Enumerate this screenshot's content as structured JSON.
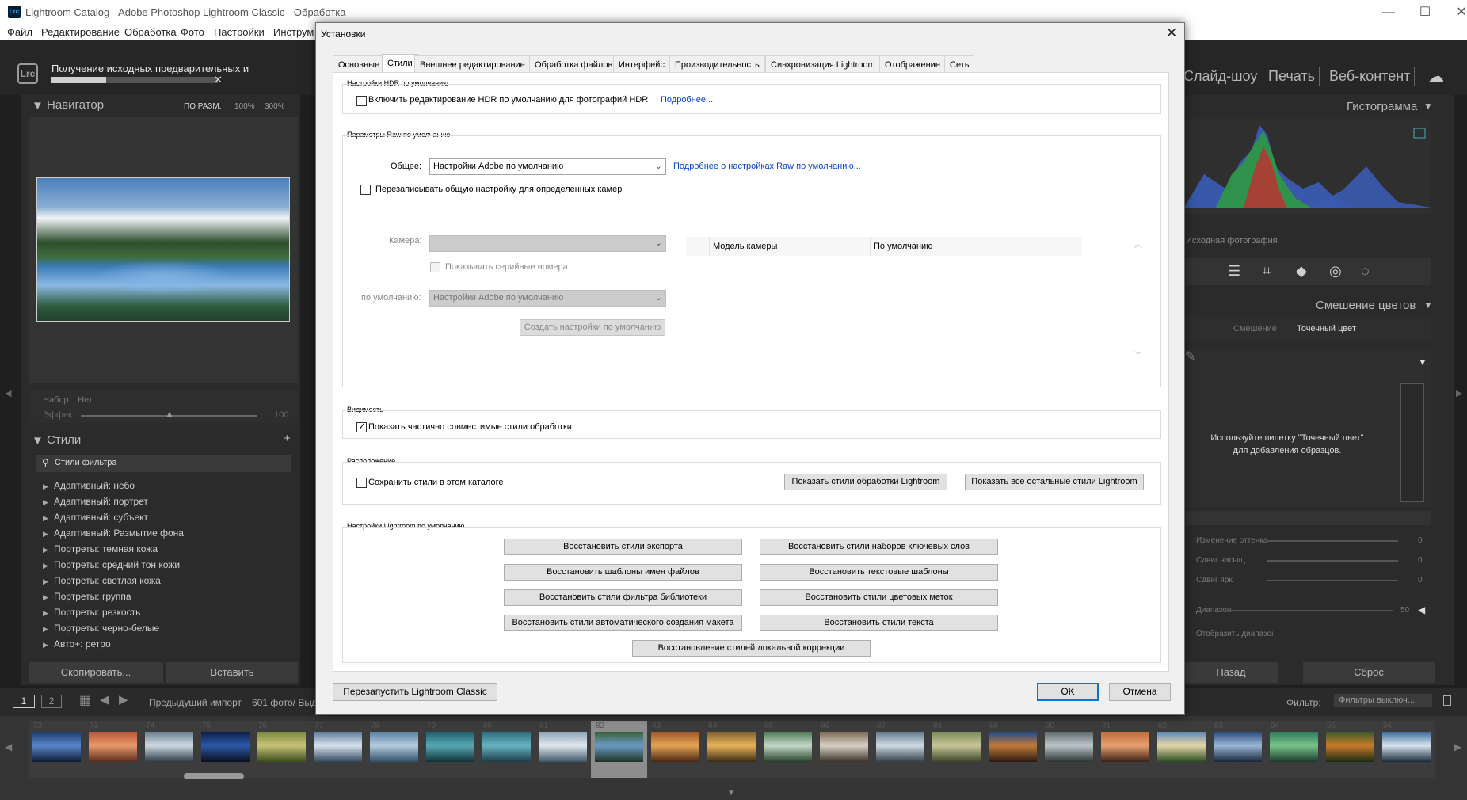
{
  "app": {
    "window_title": "Lightroom Catalog - Adobe Photoshop Lightroom Classic - Обработка",
    "logo_text": "Lrc",
    "menu": [
      "Файл",
      "Редактирование",
      "Обработка",
      "Фото",
      "Настройки",
      "Инструм"
    ],
    "import_status": "Получение исходных предварительных и",
    "import_progress_fraction": 0.33,
    "modules": [
      "Слайд-шоу",
      "Печать",
      "Веб-контент"
    ]
  },
  "left_panel": {
    "navigator_title": "Навигатор",
    "zoom_fit": "ПО РАЗМ.",
    "zoom_100": "100%",
    "zoom_300": "300%",
    "preset_label": "Набор:",
    "preset_value": "Нет",
    "effect_label": "Эффект",
    "effect_value": "100",
    "styles_title": "Стили",
    "styles_filter": "Стили фильтра",
    "style_groups": [
      "Адаптивный: небо",
      "Адаптивный: портрет",
      "Адаптивный: субъект",
      "Адаптивный: Размытие фона",
      "Портреты: темная кожа",
      "Портреты: средний тон кожи",
      "Портреты: светлая кожа",
      "Портреты: группа",
      "Портреты: резкость",
      "Портреты: черно-белые",
      "Авто+: ретро"
    ],
    "copy_button": "Скопировать...",
    "paste_button": "Вставить"
  },
  "right_panel": {
    "histogram_title": "Гистограмма",
    "original_photo": "Исходная фотография",
    "color_mix_title": "Смешение цветов",
    "tab_mix": "Смешение",
    "tab_point": "Точечный цвет",
    "point_hint_line1": "Используйте пипетку \"Точечный цвет\"",
    "point_hint_line2": "для добавления образцов.",
    "row_labels": [
      "Изменение оттенка",
      "Сдвиг насыщ.",
      "Сдвиг ярк.",
      "Диапазон"
    ],
    "row_values": [
      "0",
      "0",
      "0",
      "50"
    ],
    "show_range": "Отобразить диапазон",
    "back_button": "Назад",
    "reset_button": "Сброс"
  },
  "bottom": {
    "page_1": "1",
    "page_2": "2",
    "prev_import": "Предыдущий импорт",
    "count": "601 фото/ Выд",
    "filter_label": "Фильтр:",
    "filter_value": "Фильтры выключ..."
  },
  "filmstrip": {
    "numbers": [
      "72",
      "73",
      "74",
      "75",
      "76",
      "77",
      "78",
      "79",
      "80",
      "81",
      "82",
      "83",
      "84",
      "85",
      "86",
      "87",
      "88",
      "89",
      "90",
      "91",
      "92",
      "93",
      "94",
      "95",
      "96"
    ],
    "selected_index": 10,
    "thumb_colors": [
      [
        "#1e3a6e",
        "#5a86c8",
        "#0c1b33"
      ],
      [
        "#b8553a",
        "#e89a6b",
        "#5a2a1d"
      ],
      [
        "#6a7e8f",
        "#cfd9e2",
        "#2b3a45"
      ],
      [
        "#0c1f4a",
        "#2c58a8",
        "#0a0f1f"
      ],
      [
        "#7a8a3a",
        "#c8c37a",
        "#3a4a1a"
      ],
      [
        "#5d7b9a",
        "#d9e3ec",
        "#30465c"
      ],
      [
        "#5a7fa0",
        "#b4cde0",
        "#2f4f66"
      ],
      [
        "#1f5f6a",
        "#57a9b5",
        "#103236"
      ],
      [
        "#2c6c7a",
        "#67b4c2",
        "#1b3b44"
      ],
      [
        "#8aa2b5",
        "#e1e9ef",
        "#3d5566"
      ],
      [
        "#3c5f3a",
        "#6a9bc4",
        "#1e3324"
      ],
      [
        "#a0552a",
        "#e3a455",
        "#4a2512"
      ],
      [
        "#806030",
        "#e8b45a",
        "#3a2a12"
      ],
      [
        "#4f7a55",
        "#c4d9c8",
        "#25402a"
      ],
      [
        "#7b6a55",
        "#d8d0c4",
        "#3a3226"
      ],
      [
        "#617a8c",
        "#d0dbe3",
        "#2e3d48"
      ],
      [
        "#7a8a5a",
        "#c9c79a",
        "#3a4428"
      ],
      [
        "#1e4a8a",
        "#c07a3a",
        "#2a1a10"
      ],
      [
        "#5d6a6e",
        "#bcc6c8",
        "#2a3234"
      ],
      [
        "#c06a3a",
        "#e8a070",
        "#3a2014"
      ],
      [
        "#5a88b8",
        "#e6d7a8",
        "#2a4a22"
      ],
      [
        "#2a4a7a",
        "#9ab7d6",
        "#17253a"
      ],
      [
        "#2d7a5a",
        "#7ac48a",
        "#1a3a2a"
      ],
      [
        "#3a5a2a",
        "#c87a2a",
        "#1a2a12"
      ],
      [
        "#3a6a9a",
        "#d8e4ee",
        "#1a2a3a"
      ]
    ]
  },
  "dialog": {
    "title": "Установки",
    "tabs": [
      "Основные",
      "Стили",
      "Внешнее редактирование",
      "Обработка файлов",
      "Интерфейс",
      "Производительность",
      "Синхронизация Lightroom",
      "Отображение",
      "Сеть"
    ],
    "active_tab": 1,
    "hdr": {
      "group_label": "Настройки HDR по умолчанию",
      "checkbox_label": "Включить редактирование HDR по умолчанию для фотографий HDR",
      "checked": false,
      "learn_more": "Подробнее..."
    },
    "raw": {
      "group_label": "Параметры Raw по умолчанию",
      "general_label": "Общее:",
      "general_value": "Настройки Adobe по умолчанию",
      "learn_more": "Подробнее о настройках Raw по умолчанию...",
      "override_label": "Перезаписывать общую настройку для определенных камер",
      "override_checked": false,
      "camera_label": "Камера:",
      "camera_value": "",
      "show_serials": "Показывать серийные номера",
      "default_label": "по умолчанию:",
      "default_value": "Настройки Adobe по умолчанию",
      "create_defaults": "Создать настройки по умолчанию",
      "table_headers": [
        "Модель камеры",
        "По умолчанию"
      ]
    },
    "visibility": {
      "group_label": "Видимость",
      "checkbox_label": "Показать частично совместимые стили обработки",
      "checked": true
    },
    "location": {
      "group_label": "Расположение",
      "checkbox_label": "Сохранить стили в этом каталоге",
      "checked": false,
      "show_lr_presets": "Показать стили обработки Lightroom",
      "show_other_presets": "Показать все остальные стили Lightroom"
    },
    "defaults": {
      "group_label": "Настройки Lightroom по умолчанию",
      "buttons": [
        "Восстановить стили экспорта",
        "Восстановить стили наборов ключевых слов",
        "Восстановить шаблоны имен файлов",
        "Восстановить текстовые шаблоны",
        "Восстановить стили фильтра библиотеки",
        "Восстановить стили цветовых меток",
        "Восстановить стили автоматического создания макета",
        "Восстановить стили текста",
        "Восстановление стилей локальной коррекции"
      ]
    },
    "restart_button": "Перезапустить Lightroom Classic",
    "ok_button": "OK",
    "cancel_button": "Отмена"
  }
}
